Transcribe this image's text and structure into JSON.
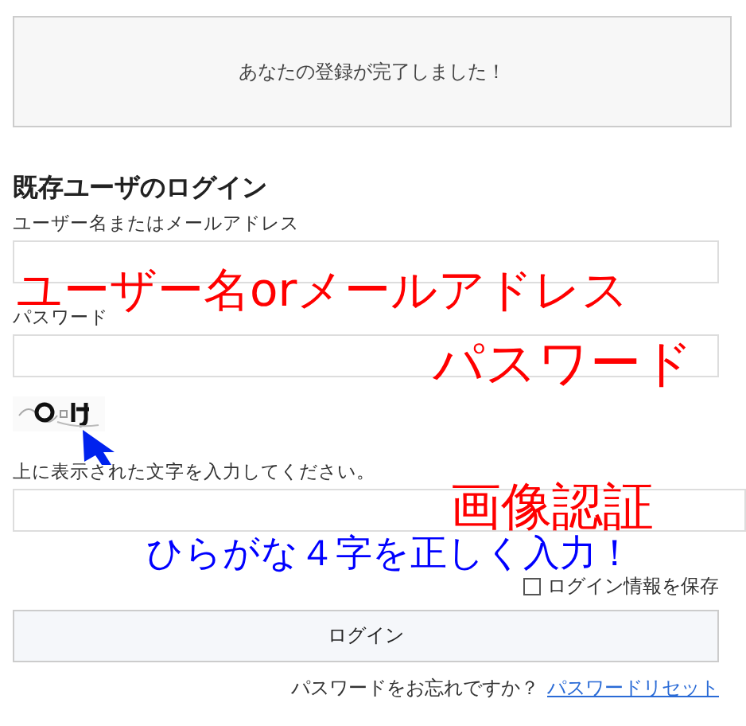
{
  "notice": "あなたの登録が完了しました！",
  "login": {
    "heading": "既存ユーザのログイン",
    "fields": [
      {
        "label": "ユーザー名またはメールアドレス"
      },
      {
        "label": "パスワード"
      }
    ],
    "captcha": {
      "kind": "picture",
      "instruction": "上に表示された文字を入力してください。"
    },
    "remember": {
      "label": "ログイン情報を保存",
      "checked": false
    },
    "submit": "ログイン",
    "forgot": {
      "text": "パスワードをお忘れですか？",
      "link": "パスワードリセット"
    }
  },
  "annotations": [
    {
      "text": "ユーザー名orメールアドレス",
      "color": "#ff0000"
    },
    {
      "text": "パスワード",
      "color": "#ff0000"
    },
    {
      "text": "画像認証",
      "color": "#ff0000"
    },
    {
      "text": "ひらがな４字を正しく入力！",
      "color": "#0000ff"
    }
  ]
}
